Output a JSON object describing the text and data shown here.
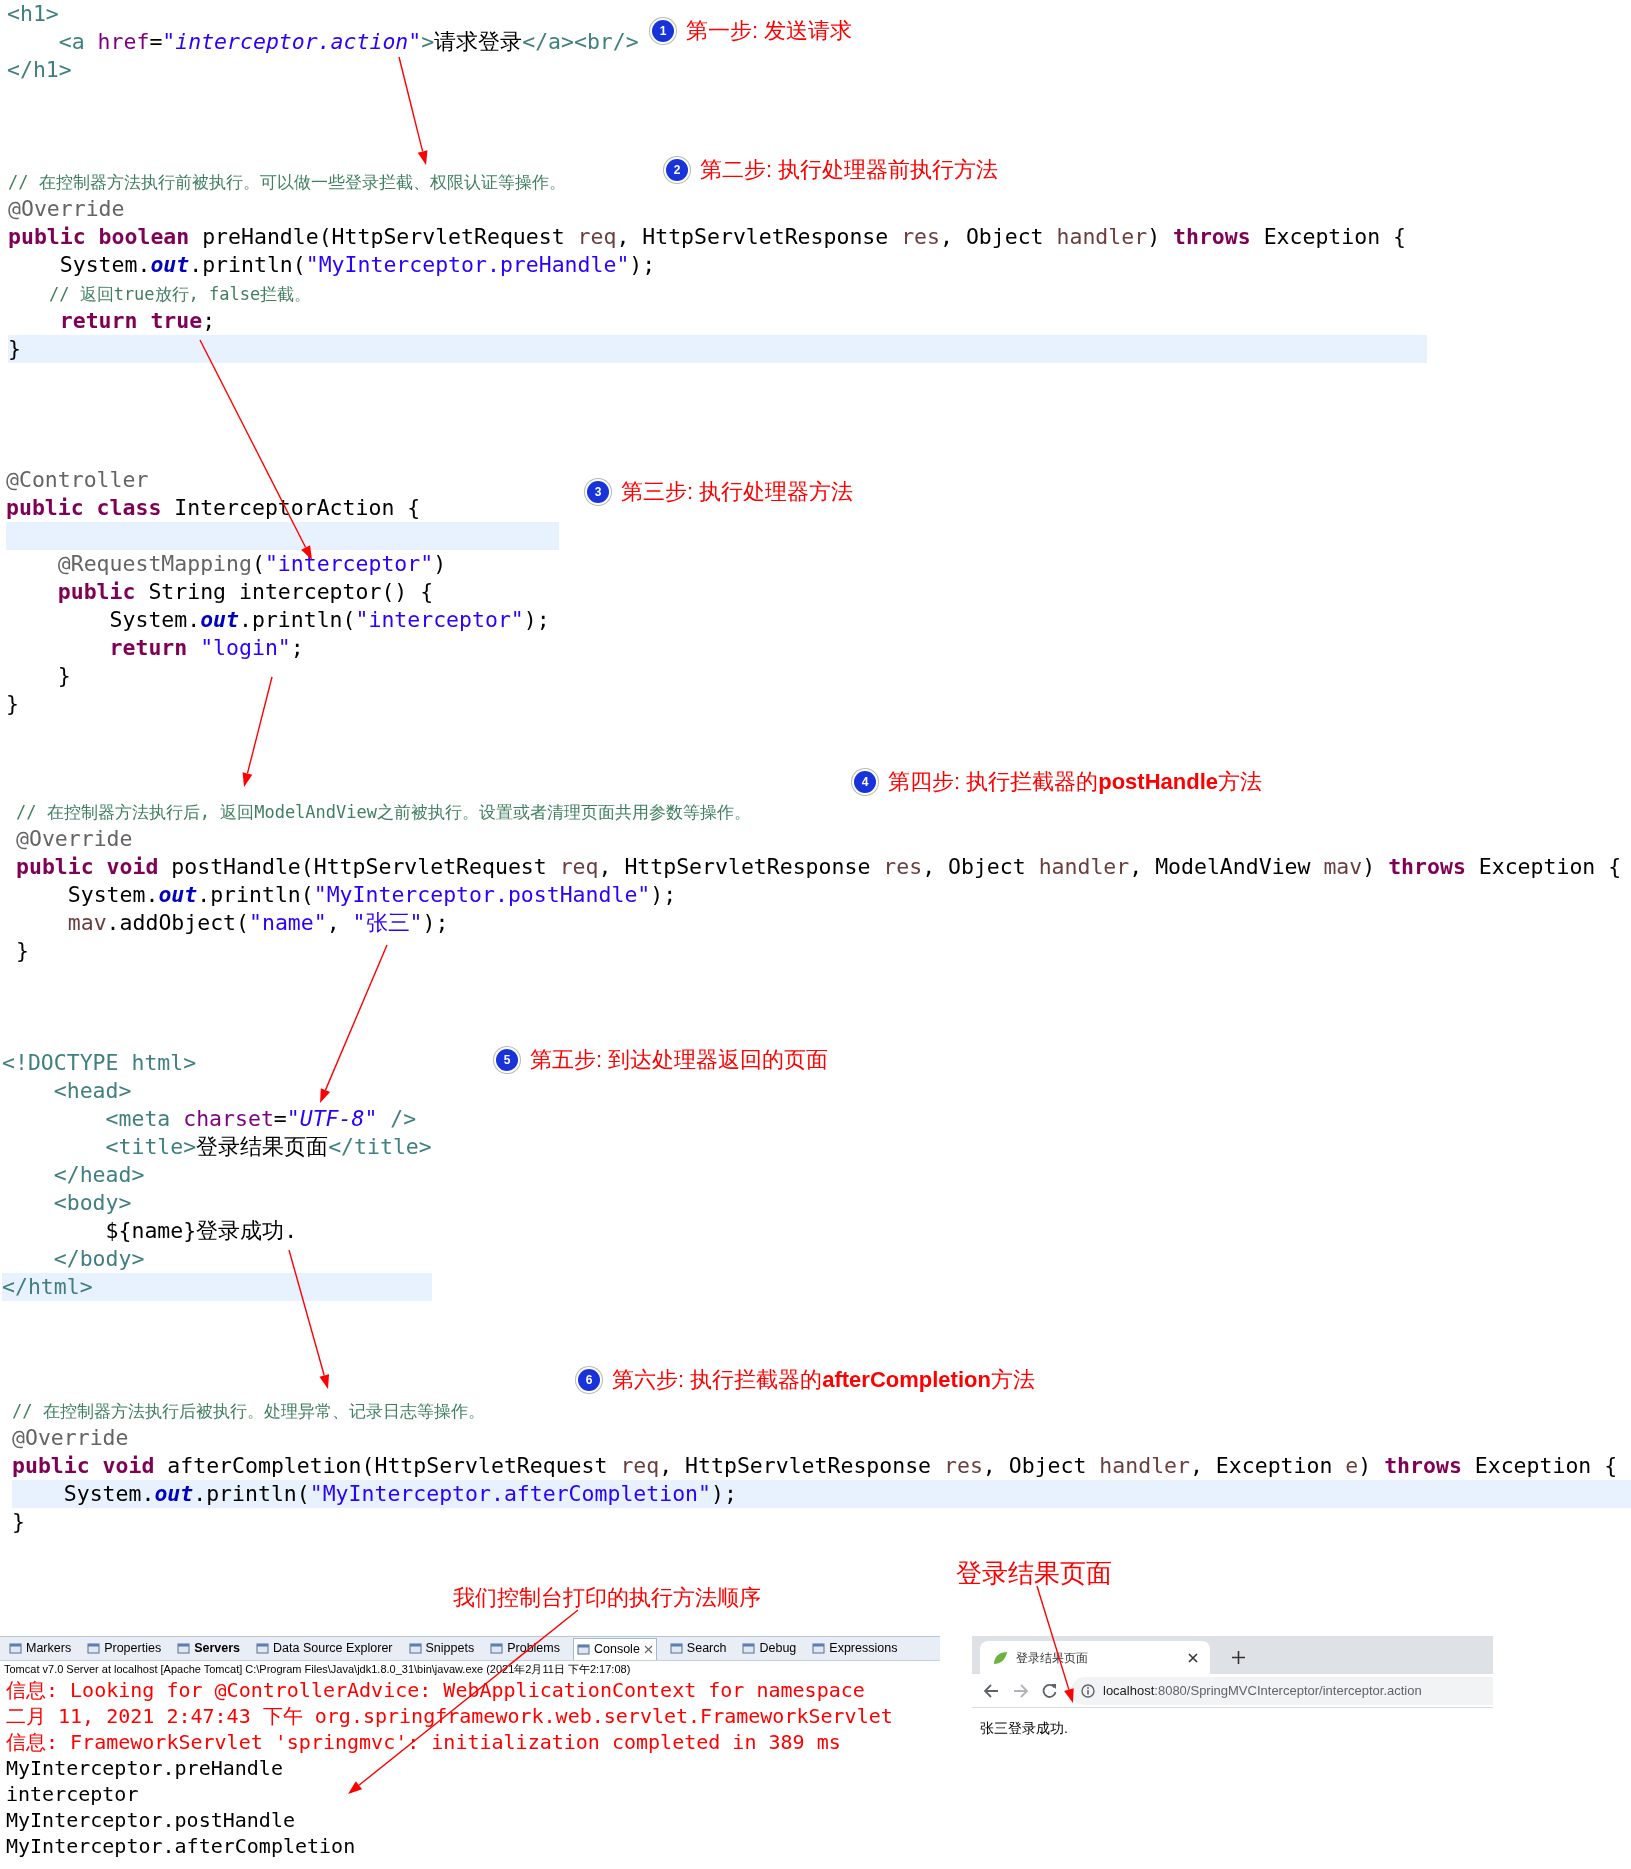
{
  "sections": [
    {
      "step": {
        "number": "1",
        "label": "第一步: 发送请求"
      },
      "lines": [
        {
          "current": false,
          "tokens": [
            {
              "kind": "tag",
              "text": "<h1>"
            }
          ]
        },
        {
          "current": false,
          "tokens": [
            {
              "kind": "tag",
              "text": "    <a "
            },
            {
              "kind": "attr",
              "text": "href"
            },
            {
              "kind": "plain",
              "text": "="
            },
            {
              "kind": "aval",
              "text": "\"interceptor.action\""
            },
            {
              "kind": "tag",
              "text": ">"
            },
            {
              "kind": "plain",
              "text": "请求登录"
            },
            {
              "kind": "tag",
              "text": "</a><br/>"
            }
          ]
        },
        {
          "current": false,
          "tokens": [
            {
              "kind": "tag",
              "text": "</h1>"
            }
          ]
        }
      ]
    },
    {
      "step": {
        "number": "2",
        "label": "第二步: 执行处理器前执行方法"
      },
      "lines": [
        {
          "current": false,
          "tokens": [
            {
              "kind": "comment",
              "text": "// 在控制器方法执行前被执行。可以做一些登录拦截、权限认证等操作。"
            }
          ]
        },
        {
          "current": false,
          "tokens": [
            {
              "kind": "ann",
              "text": "@Override"
            }
          ]
        },
        {
          "current": false,
          "tokens": [
            {
              "kind": "kw",
              "text": "public "
            },
            {
              "kind": "kw",
              "text": "boolean"
            },
            {
              "kind": "plain",
              "text": " preHandle(HttpServletRequest "
            },
            {
              "kind": "param",
              "text": "req"
            },
            {
              "kind": "plain",
              "text": ", HttpServletResponse "
            },
            {
              "kind": "param",
              "text": "res"
            },
            {
              "kind": "plain",
              "text": ", Object "
            },
            {
              "kind": "param",
              "text": "handler"
            },
            {
              "kind": "plain",
              "text": ") "
            },
            {
              "kind": "kw",
              "text": "throws"
            },
            {
              "kind": "plain",
              "text": " Exception {"
            }
          ]
        },
        {
          "current": false,
          "tokens": [
            {
              "kind": "plain",
              "text": "    System."
            },
            {
              "kind": "field",
              "text": "out"
            },
            {
              "kind": "plain",
              "text": ".println("
            },
            {
              "kind": "str",
              "text": "\"MyInterceptor.preHandle\""
            },
            {
              "kind": "plain",
              "text": ");"
            }
          ]
        },
        {
          "current": false,
          "tokens": [
            {
              "kind": "comment",
              "text": "    // 返回true放行, false拦截。"
            }
          ]
        },
        {
          "current": false,
          "tokens": [
            {
              "kind": "kw",
              "text": "    return "
            },
            {
              "kind": "kw",
              "text": "true"
            },
            {
              "kind": "plain",
              "text": ";"
            }
          ]
        },
        {
          "current": true,
          "tokens": [
            {
              "kind": "plain",
              "text": "}"
            }
          ]
        }
      ]
    },
    {
      "step": {
        "number": "3",
        "label": "第三步: 执行处理器方法"
      },
      "lines": [
        {
          "current": false,
          "tokens": [
            {
              "kind": "ann",
              "text": "@Controller"
            }
          ]
        },
        {
          "current": false,
          "tokens": [
            {
              "kind": "kw",
              "text": "public "
            },
            {
              "kind": "kw",
              "text": "class"
            },
            {
              "kind": "plain",
              "text": " InterceptorAction {"
            }
          ]
        },
        {
          "current": true
        },
        {
          "current": false,
          "tokens": [
            {
              "kind": "ann",
              "text": "    @RequestMapping"
            },
            {
              "kind": "plain",
              "text": "("
            },
            {
              "kind": "str",
              "text": "\"interceptor\""
            },
            {
              "kind": "plain",
              "text": ")"
            }
          ]
        },
        {
          "current": false,
          "tokens": [
            {
              "kind": "kw",
              "text": "    public"
            },
            {
              "kind": "plain",
              "text": " String interceptor() {"
            }
          ]
        },
        {
          "current": false,
          "tokens": [
            {
              "kind": "plain",
              "text": "        System."
            },
            {
              "kind": "field",
              "text": "out"
            },
            {
              "kind": "plain",
              "text": ".println("
            },
            {
              "kind": "str",
              "text": "\"interceptor\""
            },
            {
              "kind": "plain",
              "text": ");"
            }
          ]
        },
        {
          "current": false,
          "tokens": [
            {
              "kind": "kw",
              "text": "        return "
            },
            {
              "kind": "str",
              "text": "\"login\""
            },
            {
              "kind": "plain",
              "text": ";"
            }
          ]
        },
        {
          "current": false,
          "tokens": [
            {
              "kind": "plain",
              "text": "    }"
            }
          ]
        },
        {
          "current": false,
          "tokens": [
            {
              "kind": "plain",
              "text": "}"
            }
          ]
        }
      ]
    },
    {
      "step": {
        "number": "4",
        "label": "第四步: 执行拦截器的**postHandle**方法"
      },
      "lines": [
        {
          "current": false,
          "tokens": [
            {
              "kind": "comment",
              "text": "// 在控制器方法执行后, 返回ModelAndView之前被执行。设置或者清理页面共用参数等操作。"
            }
          ]
        },
        {
          "current": false,
          "tokens": [
            {
              "kind": "ann",
              "text": "@Override"
            }
          ]
        },
        {
          "current": false,
          "tokens": [
            {
              "kind": "kw",
              "text": "public "
            },
            {
              "kind": "kw",
              "text": "void"
            },
            {
              "kind": "plain",
              "text": " postHandle(HttpServletRequest "
            },
            {
              "kind": "param",
              "text": "req"
            },
            {
              "kind": "plain",
              "text": ", HttpServletResponse "
            },
            {
              "kind": "param",
              "text": "res"
            },
            {
              "kind": "plain",
              "text": ", Object "
            },
            {
              "kind": "param",
              "text": "handler"
            },
            {
              "kind": "plain",
              "text": ", ModelAndView "
            },
            {
              "kind": "param",
              "text": "mav"
            },
            {
              "kind": "plain",
              "text": ") "
            },
            {
              "kind": "kw",
              "text": "throws"
            },
            {
              "kind": "plain",
              "text": " Exception {"
            }
          ]
        },
        {
          "current": false,
          "tokens": [
            {
              "kind": "plain",
              "text": "    System."
            },
            {
              "kind": "field",
              "text": "out"
            },
            {
              "kind": "plain",
              "text": ".println("
            },
            {
              "kind": "str",
              "text": "\"MyInterceptor.postHandle\""
            },
            {
              "kind": "plain",
              "text": ");"
            }
          ]
        },
        {
          "current": false,
          "tokens": [
            {
              "kind": "param",
              "text": "    mav"
            },
            {
              "kind": "plain",
              "text": ".addObject("
            },
            {
              "kind": "str",
              "text": "\"name\""
            },
            {
              "kind": "plain",
              "text": ", "
            },
            {
              "kind": "str",
              "text": "\"张三\""
            },
            {
              "kind": "plain",
              "text": ");"
            }
          ]
        },
        {
          "current": false,
          "tokens": [
            {
              "kind": "plain",
              "text": "}"
            }
          ]
        }
      ]
    },
    {
      "step": {
        "number": "5",
        "label": "第五步: 到达处理器返回的页面"
      },
      "lines": [
        {
          "current": false,
          "tokens": [
            {
              "kind": "tag",
              "text": "<!DOCTYPE html>"
            }
          ]
        },
        {
          "current": false,
          "tokens": [
            {
              "kind": "tag",
              "text": "    <head>"
            }
          ]
        },
        {
          "current": false,
          "tokens": [
            {
              "kind": "tag",
              "text": "        <meta "
            },
            {
              "kind": "attr",
              "text": "charset"
            },
            {
              "kind": "plain",
              "text": "="
            },
            {
              "kind": "aval",
              "text": "\"UTF-8\""
            },
            {
              "kind": "tag",
              "text": " />"
            }
          ]
        },
        {
          "current": false,
          "tokens": [
            {
              "kind": "tag",
              "text": "        <title>"
            },
            {
              "kind": "plain",
              "text": "登录结果页面"
            },
            {
              "kind": "tag",
              "text": "</title>"
            }
          ]
        },
        {
          "current": false,
          "tokens": [
            {
              "kind": "tag",
              "text": "    </head>"
            }
          ]
        },
        {
          "current": false,
          "tokens": [
            {
              "kind": "tag",
              "text": "    <body>"
            }
          ]
        },
        {
          "current": false,
          "tokens": [
            {
              "kind": "plain",
              "text": "        ${name}登录成功."
            }
          ]
        },
        {
          "current": false,
          "tokens": [
            {
              "kind": "tag",
              "text": "    </body>"
            }
          ]
        },
        {
          "current": true,
          "tokens": [
            {
              "kind": "tag",
              "text": "</html>"
            }
          ]
        }
      ]
    },
    {
      "step": {
        "number": "6",
        "label": "第六步: 执行拦截器的**afterCompletion**方法"
      },
      "lines": [
        {
          "current": false,
          "tokens": [
            {
              "kind": "comment",
              "text": "// 在控制器方法执行后被执行。处理异常、记录日志等操作。"
            }
          ]
        },
        {
          "current": false,
          "tokens": [
            {
              "kind": "ann",
              "text": "@Override"
            }
          ]
        },
        {
          "current": false,
          "tokens": [
            {
              "kind": "kw",
              "text": "public "
            },
            {
              "kind": "kw",
              "text": "void"
            },
            {
              "kind": "plain",
              "text": " afterCompletion(HttpServletRequest "
            },
            {
              "kind": "param",
              "text": "req"
            },
            {
              "kind": "plain",
              "text": ", HttpServletResponse "
            },
            {
              "kind": "param",
              "text": "res"
            },
            {
              "kind": "plain",
              "text": ", Object "
            },
            {
              "kind": "param",
              "text": "handler"
            },
            {
              "kind": "plain",
              "text": ", Exception "
            },
            {
              "kind": "param",
              "text": "e"
            },
            {
              "kind": "plain",
              "text": ") "
            },
            {
              "kind": "kw",
              "text": "throws"
            },
            {
              "kind": "plain",
              "text": " Exception {"
            }
          ]
        },
        {
          "current": true,
          "tokens": [
            {
              "kind": "plain",
              "text": "    System."
            },
            {
              "kind": "field",
              "text": "out"
            },
            {
              "kind": "plain",
              "text": ".println("
            },
            {
              "kind": "str",
              "text": "\"MyInterceptor.afterCompletion\""
            },
            {
              "kind": "plain",
              "text": ");"
            }
          ]
        },
        {
          "current": false,
          "tokens": [
            {
              "kind": "plain",
              "text": "}"
            }
          ]
        }
      ]
    }
  ],
  "console_caption": "我们控制台打印的执行方法顺序",
  "browser_caption": "登录结果页面",
  "console": {
    "tabs": [
      {
        "label": "Markers",
        "selected": false,
        "emphasized": false
      },
      {
        "label": "Properties",
        "selected": false,
        "emphasized": false
      },
      {
        "label": "Servers",
        "selected": false,
        "emphasized": true
      },
      {
        "label": "Data Source Explorer",
        "selected": false,
        "emphasized": false
      },
      {
        "label": "Snippets",
        "selected": false,
        "emphasized": false
      },
      {
        "label": "Problems",
        "selected": false,
        "emphasized": false
      },
      {
        "label": "Console",
        "selected": true,
        "emphasized": false
      },
      {
        "label": "Search",
        "selected": false,
        "emphasized": false
      },
      {
        "label": "Debug",
        "selected": false,
        "emphasized": false
      },
      {
        "label": "Expressions",
        "selected": false,
        "emphasized": false
      }
    ],
    "status": "Tomcat v7.0 Server at localhost [Apache Tomcat] C:\\Program Files\\Java\\jdk1.8.0_31\\bin\\javaw.exe (2021年2月11日 下午2:17:08)",
    "lines": [
      {
        "kind": "error",
        "text": "信息: Looking for @ControllerAdvice: WebApplicationContext for namespace"
      },
      {
        "kind": "error",
        "text": "二月 11, 2021 2:47:43 下午 org.springframework.web.servlet.FrameworkServlet"
      },
      {
        "kind": "error",
        "text": "信息: FrameworkServlet 'springmvc': initialization completed in 389 ms"
      },
      {
        "kind": "out",
        "text": "MyInterceptor.preHandle"
      },
      {
        "kind": "out",
        "text": "interceptor"
      },
      {
        "kind": "out",
        "text": "MyInterceptor.postHandle"
      },
      {
        "kind": "out",
        "text": "MyInterceptor.afterCompletion"
      }
    ]
  },
  "browser": {
    "tab_title": "登录结果页面",
    "url_host": "localhost",
    "url_path": ":8080/SpringMVCInterceptor/interceptor.action",
    "content": "张三登录成功."
  }
}
